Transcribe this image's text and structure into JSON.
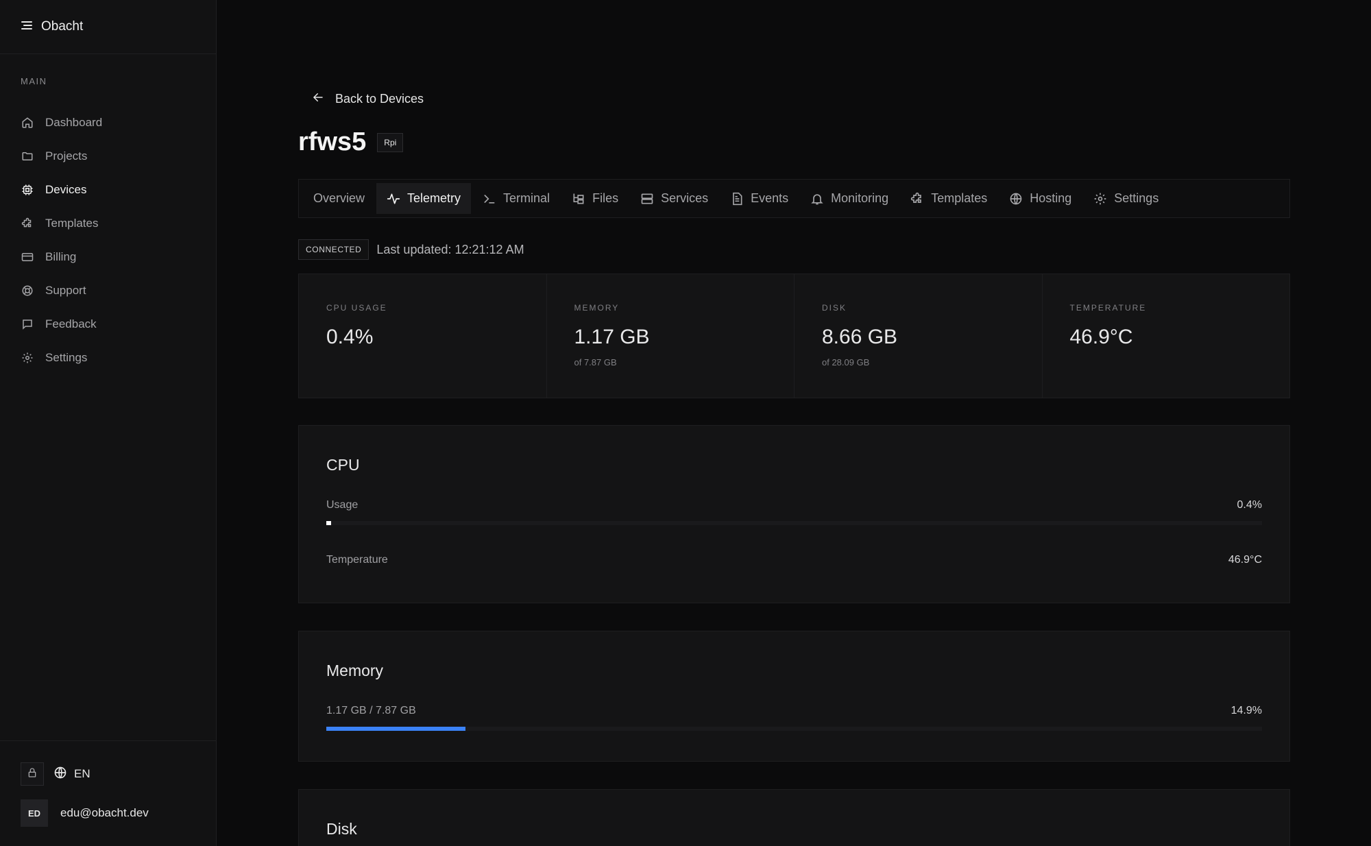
{
  "app": {
    "name": "Obacht"
  },
  "sidebar": {
    "section_label": "MAIN",
    "items": [
      {
        "label": "Dashboard",
        "icon": "home-icon",
        "active": false
      },
      {
        "label": "Projects",
        "icon": "folder-icon",
        "active": false
      },
      {
        "label": "Devices",
        "icon": "chip-icon",
        "active": true
      },
      {
        "label": "Templates",
        "icon": "puzzle-icon",
        "active": false
      },
      {
        "label": "Billing",
        "icon": "credit-card-icon",
        "active": false
      },
      {
        "label": "Support",
        "icon": "lifebuoy-icon",
        "active": false
      },
      {
        "label": "Feedback",
        "icon": "message-icon",
        "active": false
      },
      {
        "label": "Settings",
        "icon": "gear-icon",
        "active": false
      }
    ],
    "language": "EN",
    "user": {
      "initials": "ED",
      "email": "edu@obacht.dev"
    }
  },
  "header": {
    "back_label": "Back to Devices",
    "device_name": "rfws5",
    "device_badge": "Rpi"
  },
  "tabs": [
    {
      "label": "Overview",
      "icon": "",
      "active": false
    },
    {
      "label": "Telemetry",
      "icon": "activity-icon",
      "active": true
    },
    {
      "label": "Terminal",
      "icon": "terminal-icon",
      "active": false
    },
    {
      "label": "Files",
      "icon": "files-icon",
      "active": false
    },
    {
      "label": "Services",
      "icon": "server-icon",
      "active": false
    },
    {
      "label": "Events",
      "icon": "document-icon",
      "active": false
    },
    {
      "label": "Monitoring",
      "icon": "bell-icon",
      "active": false
    },
    {
      "label": "Templates",
      "icon": "puzzle-icon",
      "active": false
    },
    {
      "label": "Hosting",
      "icon": "globe-icon",
      "active": false
    },
    {
      "label": "Settings",
      "icon": "gear-icon",
      "active": false
    }
  ],
  "status": {
    "connection": "CONNECTED",
    "last_updated": "Last updated: 12:21:12 AM"
  },
  "stats": [
    {
      "label": "CPU USAGE",
      "value": "0.4%",
      "sub": ""
    },
    {
      "label": "MEMORY",
      "value": "1.17 GB",
      "sub": "of 7.87 GB"
    },
    {
      "label": "DISK",
      "value": "8.66 GB",
      "sub": "of 28.09 GB"
    },
    {
      "label": "TEMPERATURE",
      "value": "46.9°C",
      "sub": ""
    }
  ],
  "cpu_card": {
    "title": "CPU",
    "usage_label": "Usage",
    "usage_value": "0.4%",
    "usage_fraction": 0.004,
    "temperature_label": "Temperature",
    "temperature_value": "46.9°C"
  },
  "memory_card": {
    "title": "Memory",
    "usage_label": "1.17 GB / 7.87 GB",
    "usage_value": "14.9%",
    "usage_fraction": 0.149
  },
  "disk_card": {
    "title": "Disk"
  },
  "colors": {
    "accent": "#3b82f6",
    "cpu_bar": "#ffffff"
  }
}
